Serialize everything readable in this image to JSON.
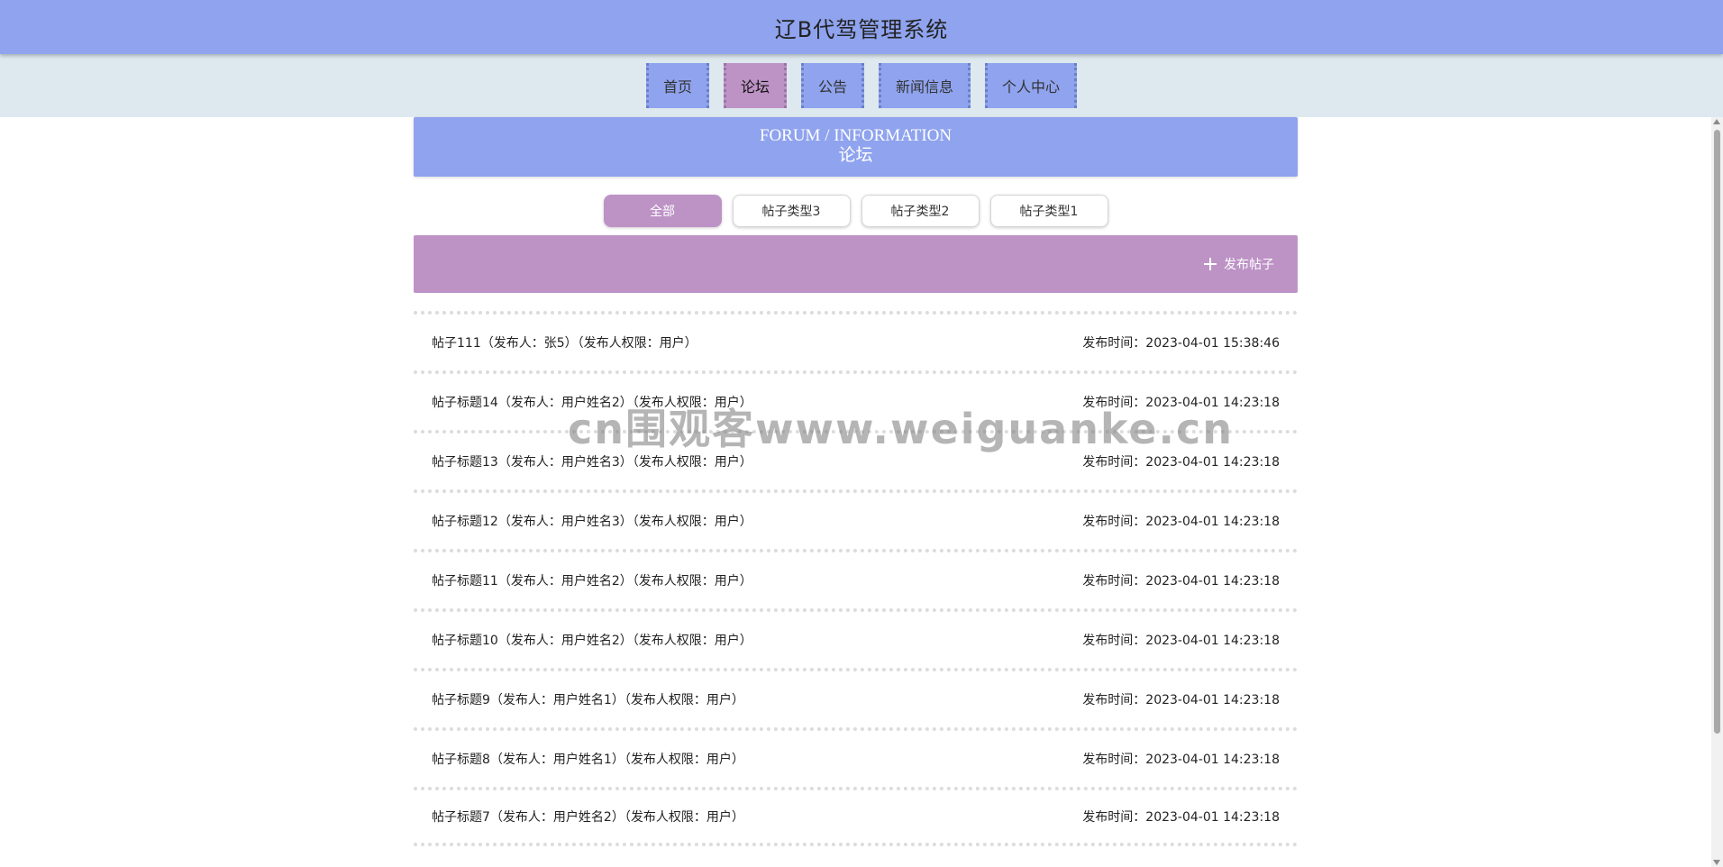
{
  "app": {
    "title": "辽B代驾管理系统"
  },
  "nav": {
    "items": [
      {
        "label": "首页"
      },
      {
        "label": "论坛"
      },
      {
        "label": "公告"
      },
      {
        "label": "新闻信息"
      },
      {
        "label": "个人中心"
      }
    ],
    "active": "论坛"
  },
  "banner": {
    "en": "FORUM / INFORMATION",
    "cn": "论坛"
  },
  "filters": {
    "items": [
      {
        "label": "全部"
      },
      {
        "label": "帖子类型3"
      },
      {
        "label": "帖子类型2"
      },
      {
        "label": "帖子类型1"
      }
    ],
    "active": "全部"
  },
  "actions": {
    "publish_label": "发布帖子",
    "publish_icon": "plus-icon"
  },
  "posts": [
    {
      "title": "帖子111（发布人：张5）（发布人权限：用户）",
      "time": "发布时间：2023-04-01 15:38:46"
    },
    {
      "title": "帖子标题14（发布人：用户姓名2）（发布人权限：用户）",
      "time": "发布时间：2023-04-01 14:23:18"
    },
    {
      "title": "帖子标题13（发布人：用户姓名3）（发布人权限：用户）",
      "time": "发布时间：2023-04-01 14:23:18"
    },
    {
      "title": "帖子标题12（发布人：用户姓名3）（发布人权限：用户）",
      "time": "发布时间：2023-04-01 14:23:18"
    },
    {
      "title": "帖子标题11（发布人：用户姓名2）（发布人权限：用户）",
      "time": "发布时间：2023-04-01 14:23:18"
    },
    {
      "title": "帖子标题10（发布人：用户姓名2）（发布人权限：用户）",
      "time": "发布时间：2023-04-01 14:23:18"
    },
    {
      "title": "帖子标题9（发布人：用户姓名1）（发布人权限：用户）",
      "time": "发布时间：2023-04-01 14:23:18"
    },
    {
      "title": "帖子标题8（发布人：用户姓名1）（发布人权限：用户）",
      "time": "发布时间：2023-04-01 14:23:18"
    },
    {
      "title": "帖子标题7（发布人：用户姓名2）（发布人权限：用户）",
      "time": "发布时间：2023-04-01 14:23:18"
    }
  ],
  "watermark": "cn围观客www.weiguanke.cn",
  "colors": {
    "header": "#8fa3ee",
    "nav_bg": "#dde8ef",
    "accent": "#bd93c6"
  }
}
